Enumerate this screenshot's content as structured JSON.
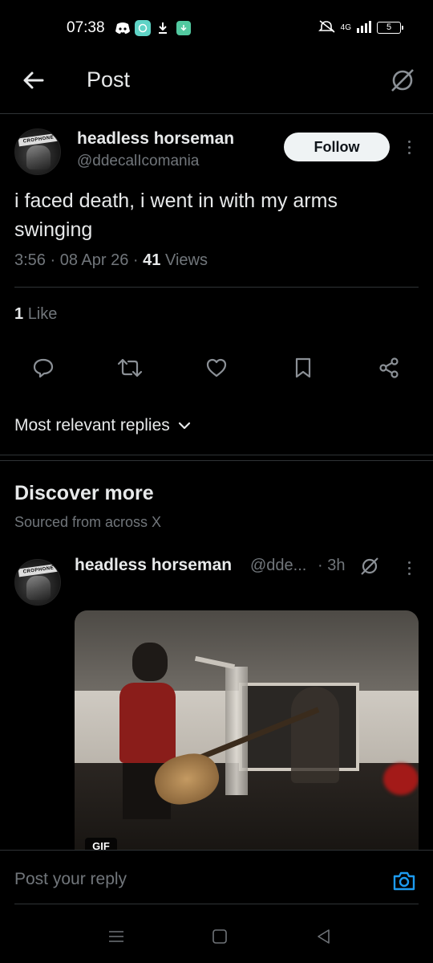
{
  "status_bar": {
    "time": "07:38",
    "network": "4G",
    "battery": "5",
    "icons": [
      "discord-icon",
      "message-app-icon",
      "download-icon",
      "download-app-icon",
      "mute-icon",
      "signal-icon",
      "battery-icon"
    ]
  },
  "header": {
    "title": "Post",
    "back_icon": "arrow-left-icon",
    "grok_icon": "grok-icon"
  },
  "post": {
    "display_name": "headless horseman",
    "handle": "@ddecalIcomania",
    "follow_label": "Follow",
    "text": "i faced death, i went in with my arms swinging",
    "time": "3:56",
    "date": "08 Apr 26",
    "views_count": "41",
    "views_label": "Views",
    "separator": "·",
    "likes_count": "1",
    "likes_label": "Like",
    "avatar_text": "CROPHONE"
  },
  "actions": [
    "reply-icon",
    "repost-icon",
    "like-icon",
    "bookmark-icon",
    "share-icon"
  ],
  "replies": {
    "sort_label": "Most relevant replies"
  },
  "discover": {
    "title": "Discover more",
    "subtitle": "Sourced from across X",
    "item": {
      "display_name": "headless horseman",
      "handle": "@dde...",
      "time": "· 3h",
      "media_badge": "GIF",
      "avatar_text": "CROPHONE"
    }
  },
  "reply_bar": {
    "placeholder": "Post your reply",
    "camera_icon": "camera-icon"
  },
  "nav_bar": [
    "menu-icon",
    "home-icon",
    "back-icon"
  ],
  "colors": {
    "background": "#000000",
    "text_primary": "#e7e9ea",
    "text_secondary": "#71767b",
    "divider": "#2f3336",
    "accent": "#1d9bf0",
    "follow_bg": "#eff3f4"
  }
}
